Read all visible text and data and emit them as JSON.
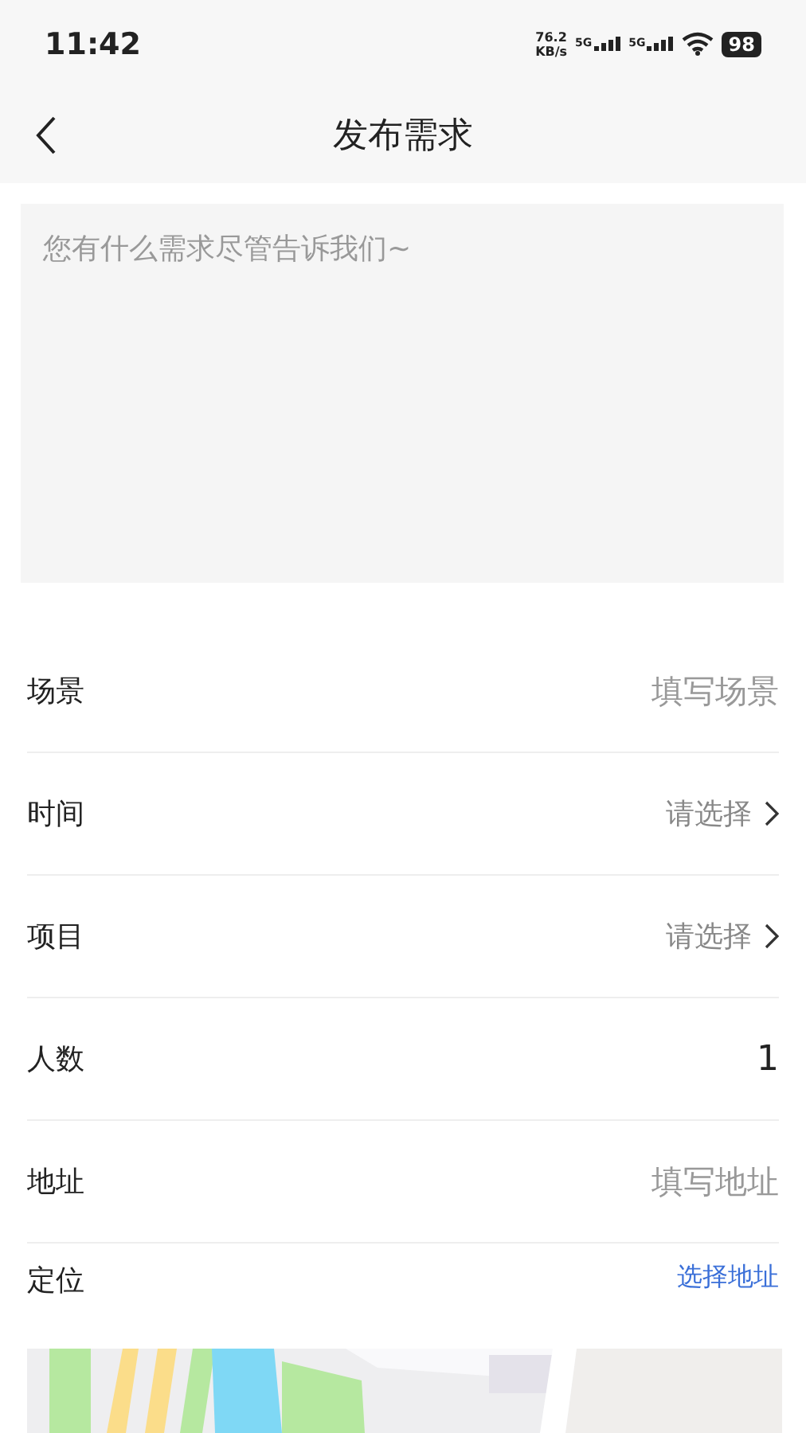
{
  "status_bar": {
    "time": "11:42",
    "speed": "76.2",
    "speed_unit": "KB/s",
    "networks": [
      "5G",
      "5G"
    ],
    "battery": "98"
  },
  "header": {
    "title": "发布需求"
  },
  "description": {
    "placeholder": "您有什么需求尽管告诉我们~"
  },
  "rows": [
    {
      "kind": "input",
      "label": "场景",
      "placeholder": "填写场景"
    },
    {
      "kind": "select",
      "label": "时间",
      "placeholder": "请选择"
    },
    {
      "kind": "select",
      "label": "项目",
      "placeholder": "请选择"
    },
    {
      "kind": "value",
      "label": "人数",
      "value": "1"
    },
    {
      "kind": "input",
      "label": "地址",
      "placeholder": "填写地址"
    },
    {
      "kind": "link",
      "label": "定位",
      "value": "选择地址"
    }
  ]
}
